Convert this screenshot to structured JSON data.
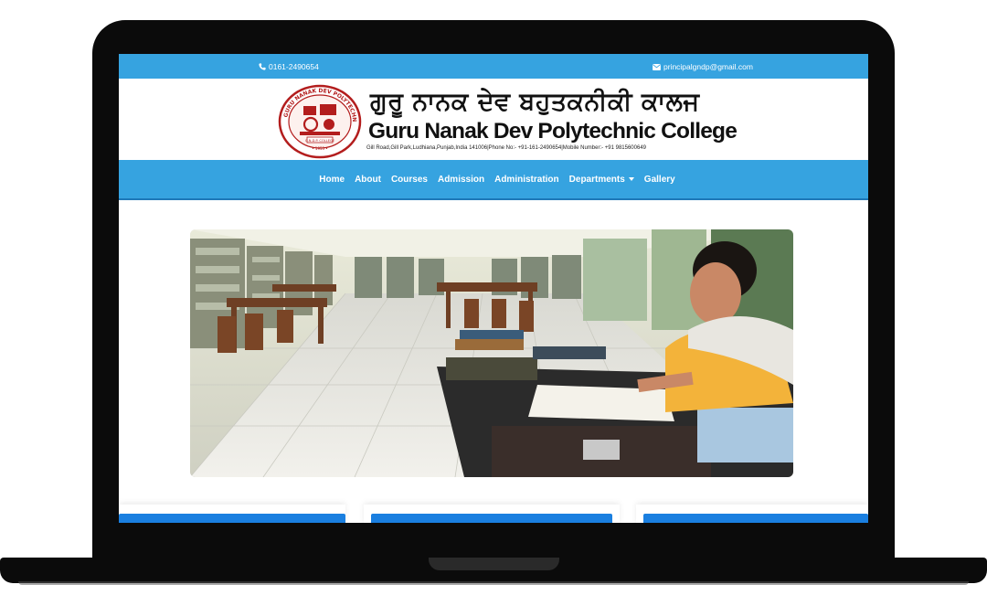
{
  "topbar": {
    "phone": "0161-2490654",
    "email": "principalgndp@gmail.com",
    "phone_icon": "phone-icon",
    "email_icon": "envelope-icon"
  },
  "brand": {
    "title_punjabi": "ਗੁਰੂ ਨਾਨਕ ਦੇਵ ਬਹੁਤਕਨੀਕੀ ਕਾਲਜ",
    "title_english": "Guru Nanak Dev Polytechnic College",
    "address": "Gill Road,Gill Park,Ludhiana,Punjab,India 141006|Phone No:- +91-161-2490654|Mobile Number:- +91 9815600649",
    "logo_text": "GURU NANAK DEV POLYTECHNIC COLLEGE, LUDHIANA"
  },
  "nav": {
    "items": [
      {
        "label": "Home"
      },
      {
        "label": "About"
      },
      {
        "label": "Courses"
      },
      {
        "label": "Admission"
      },
      {
        "label": "Administration"
      },
      {
        "label": "Departments"
      },
      {
        "label": "Gallery"
      }
    ]
  },
  "colors": {
    "topbar": "#36a3e0",
    "navbar": "#36a3e0",
    "card_header": "#1a7fe0"
  },
  "hero": {
    "description_icon": "library-photo"
  }
}
